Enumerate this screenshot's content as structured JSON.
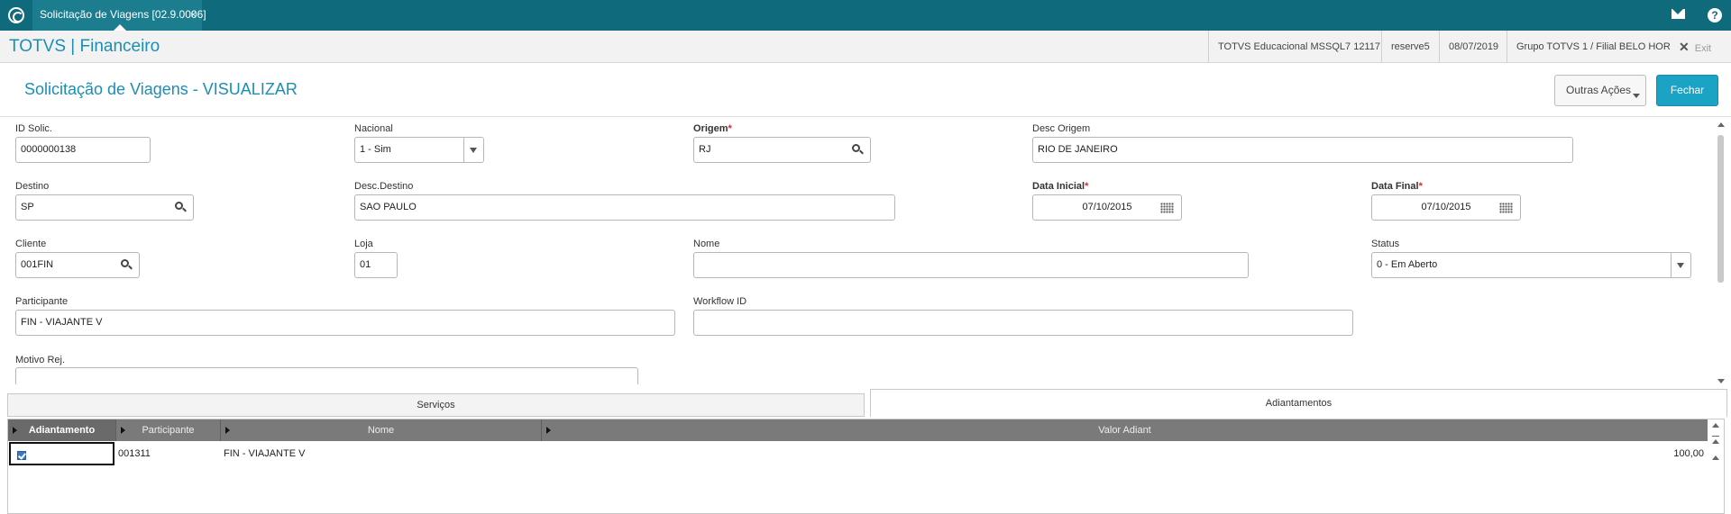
{
  "topbar": {
    "tab_title": "Solicitação de Viagens [02.9.0006]",
    "close_glyph": "×",
    "help_glyph": "?"
  },
  "header": {
    "brand": "TOTVS | Financeiro",
    "environment": "TOTVS Educacional MSSQL7 12117",
    "user": "reserve5",
    "date": "08/07/2019",
    "group": "Grupo TOTVS 1 / Filial BELO HOR",
    "exit_label": "Exit",
    "exit_glyph": "✕"
  },
  "page": {
    "title": "Solicitação de Viagens - VISUALIZAR",
    "outras_acoes_label": "Outras Ações",
    "fechar_label": "Fechar"
  },
  "form": {
    "id_solic": {
      "label": "ID Solic.",
      "value": "0000000138"
    },
    "nacional": {
      "label": "Nacional",
      "value": "1 - Sim"
    },
    "origem": {
      "label": "Origem",
      "value": "RJ"
    },
    "desc_origem": {
      "label": "Desc Origem",
      "value": "RIO DE JANEIRO"
    },
    "destino": {
      "label": "Destino",
      "value": "SP"
    },
    "desc_destino": {
      "label": "Desc.Destino",
      "value": "SAO PAULO"
    },
    "data_inicial": {
      "label": "Data Inicial",
      "value": "07/10/2015"
    },
    "data_final": {
      "label": "Data Final",
      "value": "07/10/2015"
    },
    "cliente": {
      "label": "Cliente",
      "value": "001FIN"
    },
    "loja": {
      "label": "Loja",
      "value": "01"
    },
    "nome": {
      "label": "Nome",
      "value": ""
    },
    "status": {
      "label": "Status",
      "value": "0 - Em Aberto"
    },
    "participante": {
      "label": "Participante",
      "value": "FIN - VIAJANTE V"
    },
    "workflow_id": {
      "label": "Workflow ID",
      "value": ""
    },
    "motivo_rej": {
      "label": "Motivo Rej.",
      "value": ""
    },
    "required_marker": "*"
  },
  "folders": [
    {
      "label": "Serviços",
      "active": false
    },
    {
      "label": "Adiantamentos",
      "active": true
    }
  ],
  "grid": {
    "columns": [
      "Adiantamento",
      "Participante",
      "Nome",
      "Valor Adiant"
    ],
    "rows": [
      {
        "adiantamento": true,
        "participante": "001311",
        "nome": "FIN - VIAJANTE V",
        "valor": "100,00"
      }
    ]
  },
  "colors": {
    "topbar": "#0f6b7c",
    "accent": "#1a8fb5",
    "button": "#1ba3c6",
    "required": "#d9272e",
    "grid_header": "#7a7a7a"
  }
}
